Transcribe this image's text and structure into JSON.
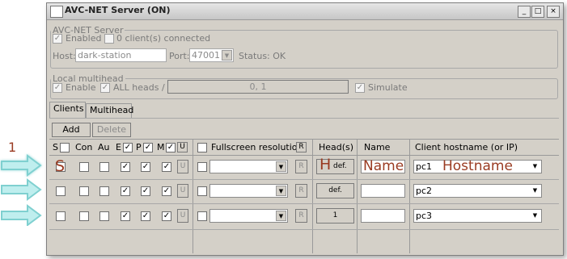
{
  "annotation": {
    "step_number": "1"
  },
  "window": {
    "title": "AVC-NET Server (ON)",
    "controls": {
      "minimize": "_",
      "maximize": "□",
      "close": "×"
    }
  },
  "server": {
    "legend": "AVC-NET Server",
    "enabled_label": "Enabled",
    "enabled_checked": true,
    "clients_connected_label": "0 client(s) connected",
    "host_label": "Host:",
    "host_value": "dark-station",
    "port_label": "Port:",
    "port_value": "47001",
    "status_label": "Status: OK"
  },
  "local_multihead": {
    "legend": "Local multihead",
    "enable_label": "Enable",
    "all_heads_label": "ALL heads /",
    "heads_value": "0, 1",
    "simulate_label": "Simulate"
  },
  "tabs": [
    {
      "label": "Clients",
      "active": true
    },
    {
      "label": "Multihead",
      "active": false
    }
  ],
  "toolbar": {
    "add_label": "Add",
    "delete_label": "Delete"
  },
  "columns": {
    "s": "S",
    "con": "Con",
    "au": "Au",
    "e": "E",
    "p": "P",
    "m": "M",
    "u": "U",
    "fullscreen": "Fullscreen resolution",
    "r": "R",
    "heads": "Head(s)",
    "name": "Name",
    "hostname": "Client hostname (or IP)"
  },
  "rows": [
    {
      "s_overlay": "S",
      "head": "def.",
      "head_overlay": "H",
      "name": "",
      "name_overlay": "Name",
      "host": "pc1",
      "host_overlay": "Hostname"
    },
    {
      "s_overlay": "",
      "head": "def.",
      "head_overlay": "",
      "name": "",
      "name_overlay": "",
      "host": "pc2",
      "host_overlay": ""
    },
    {
      "s_overlay": "",
      "head": "1",
      "head_overlay": "",
      "name": "",
      "name_overlay": "",
      "host": "pc3",
      "host_overlay": ""
    }
  ],
  "check_glyph": "✓",
  "arrow_glyph": "▼",
  "colors": {
    "annotation_red": "#9a3b22",
    "arrow_teal": "#7fd0d0"
  }
}
